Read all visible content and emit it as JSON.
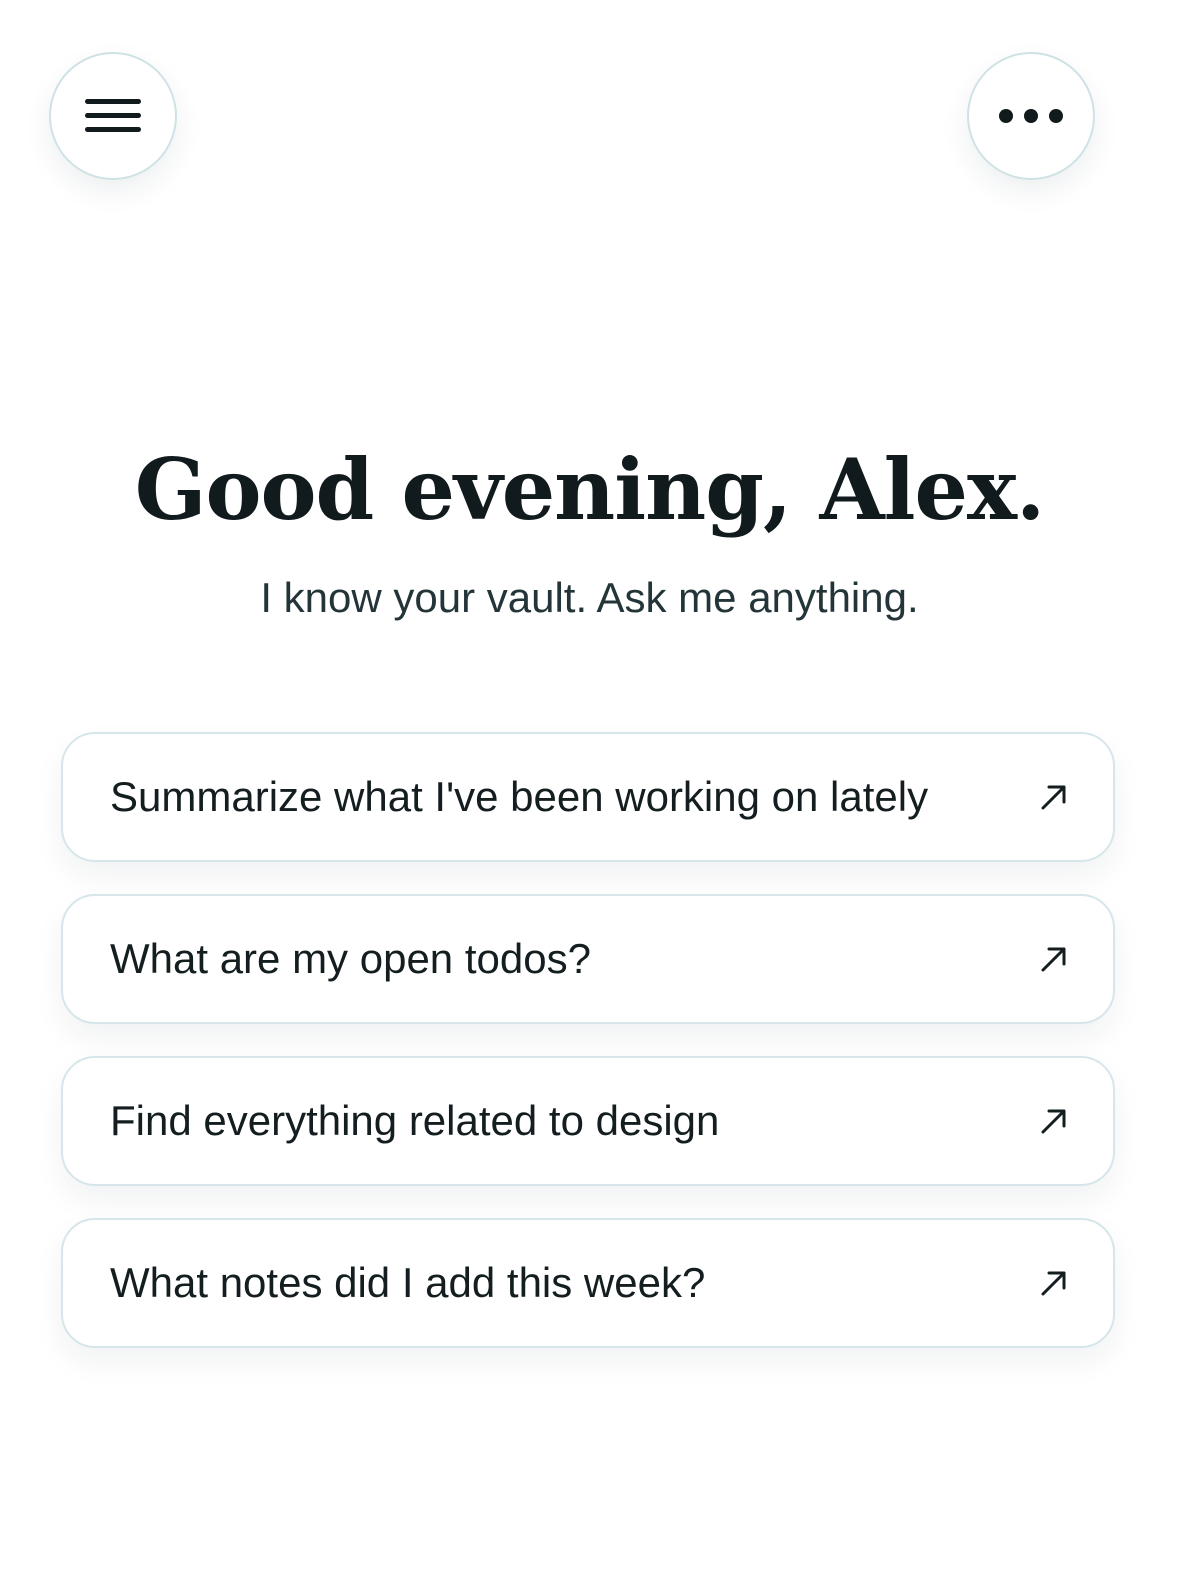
{
  "header": {
    "menu_icon": "hamburger-menu-icon",
    "more_icon": "more-horizontal-icon"
  },
  "hero": {
    "greeting": "Good evening, Alex.",
    "subtitle": "I know your vault. Ask me anything."
  },
  "suggestions": [
    {
      "label": "Summarize what I've been working on lately",
      "icon": "arrow-up-right-icon"
    },
    {
      "label": "What are my open todos?",
      "icon": "arrow-up-right-icon"
    },
    {
      "label": "Find everything related to design",
      "icon": "arrow-up-right-icon"
    },
    {
      "label": "What notes did I add this week?",
      "icon": "arrow-up-right-icon"
    }
  ],
  "colors": {
    "border": "#cfe2e6",
    "text": "#141d1f",
    "subtitle": "#243539",
    "background": "#ffffff"
  }
}
